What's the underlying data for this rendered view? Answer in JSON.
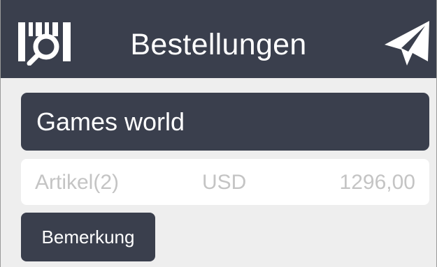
{
  "header": {
    "title": "Bestellungen",
    "left_icon": "barcode-scan-icon",
    "right_icon": "send-icon"
  },
  "order": {
    "customer_name": "Games world",
    "items_label": "Artikel(2)",
    "currency": "USD",
    "total": "1296,00"
  },
  "actions": {
    "remark_label": "Bemerkung"
  },
  "colors": {
    "primary": "#3a3f4d",
    "background": "#eeeeee",
    "muted_text": "#c4c4c4"
  }
}
